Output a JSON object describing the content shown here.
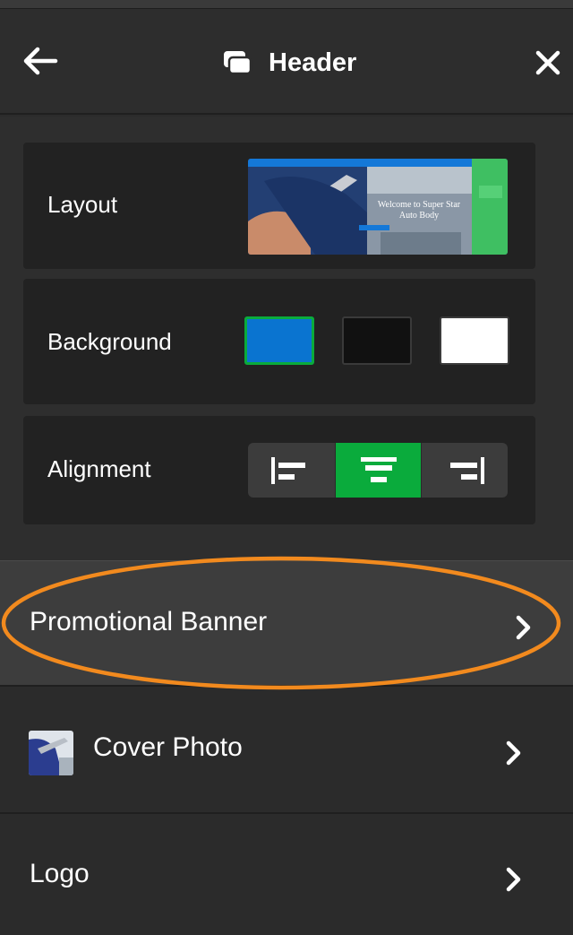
{
  "header": {
    "title": "Header",
    "back_icon": "arrow-left-icon",
    "close_icon": "close-icon",
    "title_icon": "layers-icon"
  },
  "settings": {
    "layout": {
      "label": "Layout",
      "preview_text": "Welcome to Super Star Auto Body"
    },
    "background": {
      "label": "Background",
      "swatches": [
        {
          "name": "blue",
          "color": "#0a74d0",
          "selected": true
        },
        {
          "name": "black",
          "color": "#111111",
          "selected": false
        },
        {
          "name": "white",
          "color": "#ffffff",
          "selected": false
        }
      ]
    },
    "alignment": {
      "label": "Alignment",
      "options": [
        {
          "name": "left",
          "icon": "align-left-icon",
          "selected": false
        },
        {
          "name": "center",
          "icon": "align-center-icon",
          "selected": true
        },
        {
          "name": "right",
          "icon": "align-right-icon",
          "selected": false
        }
      ]
    }
  },
  "rows": [
    {
      "label": "Promotional Banner",
      "highlighted": true
    },
    {
      "label": "Cover Photo",
      "has_thumbnail": true
    },
    {
      "label": "Logo"
    }
  ],
  "colors": {
    "accent_green": "#0aab3c",
    "annotation_orange": "#f28a1e",
    "panel_bg": "#2b2b2b",
    "card_bg": "#222222"
  }
}
